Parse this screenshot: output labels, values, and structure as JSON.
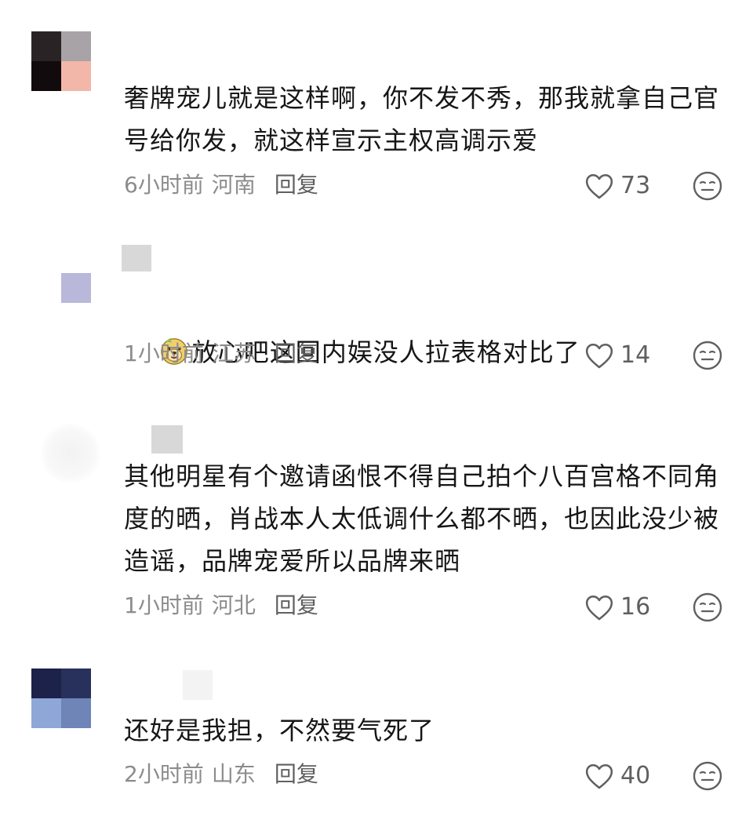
{
  "comments": [
    {
      "text": "奢牌宠儿就是这样啊，你不发不秀，那我就拿自己官号给你发，就这样宣示主权高调示爱",
      "time": "6小时前",
      "location": "河南",
      "reply_label": "回复",
      "likes": "73",
      "avatar_colors": [
        "#2a2325",
        "#a7a3a6",
        "#120b0d",
        "#f3b7a9"
      ]
    },
    {
      "emoji": "dog-emoji",
      "text": "放心吧这回内娱没人拉表格对比了",
      "time": "1小时前",
      "location": "江苏",
      "reply_label": "回复",
      "likes": "14",
      "avatar_colors": [
        "#b9b7da"
      ]
    },
    {
      "text": "其他明星有个邀请函恨不得自己拍个八百宫格不同角度的晒，肖战本人太低调什么都不晒，也因此没少被造谣，品牌宠爱所以品牌来晒",
      "time": "1小时前",
      "location": "河北",
      "reply_label": "回复",
      "likes": "16"
    },
    {
      "text": "还好是我担，不然要气死了",
      "time": "2小时前",
      "location": "山东",
      "reply_label": "回复",
      "likes": "40",
      "avatar_colors": [
        "#1c2249",
        "#27315c",
        "#8ea7d6",
        "#6f84b7"
      ]
    }
  ],
  "icons": {
    "like": "heart-outline-icon",
    "dislike": "neutral-face-icon"
  },
  "colors": {
    "text": "#161616",
    "meta": "#8c8c8c",
    "reply": "#606060"
  }
}
